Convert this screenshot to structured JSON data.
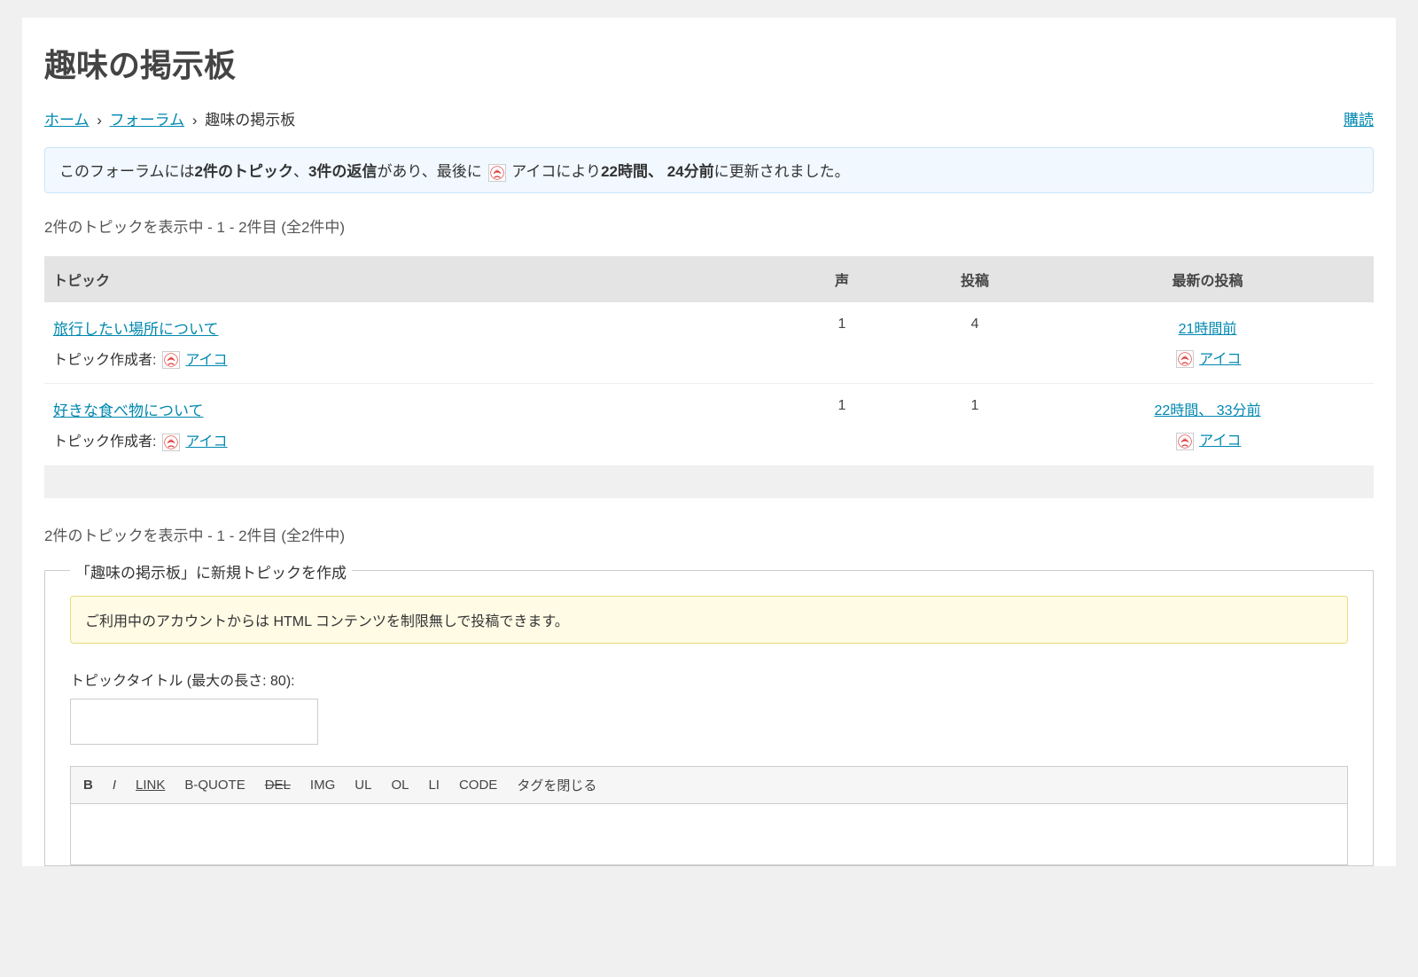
{
  "page": {
    "title": "趣味の掲示板"
  },
  "breadcrumb": {
    "home": "ホーム",
    "forums": "フォーラム",
    "current": "趣味の掲示板",
    "subscribe": "購読"
  },
  "notice": {
    "part1": "このフォーラムには",
    "topics": "2件のトピック",
    "sep1": "、",
    "replies": "3件の返信",
    "part2": "があり、最後に",
    "avatar_alt": "アバター",
    "author": "アイコ",
    "part3": "により",
    "time": "22時間、 24分前",
    "part4": "に更新されました。"
  },
  "pagination": {
    "top": "2件のトピックを表示中 - 1 - 2件目 (全2件中)",
    "bottom": "2件のトピックを表示中 - 1 - 2件目 (全2件中)"
  },
  "table": {
    "headers": {
      "topic": "トピック",
      "voice": "声",
      "post": "投稿",
      "freshness": "最新の投稿"
    },
    "starter_label": "トピック作成者:",
    "rows": [
      {
        "title": "旅行したい場所について",
        "author": "アイコ",
        "voices": "1",
        "posts": "4",
        "time": "21時間前",
        "last_author": "アイコ"
      },
      {
        "title": "好きな食べ物について",
        "author": "アイコ",
        "voices": "1",
        "posts": "1",
        "time": "22時間、 33分前",
        "last_author": "アイコ"
      }
    ]
  },
  "form": {
    "legend": "「趣味の掲示板」に新規トピックを作成",
    "warning": "ご利用中のアカウントからは HTML コンテンツを制限無しで投稿できます。",
    "title_label": "トピックタイトル (最大の長さ: 80):"
  },
  "toolbar": {
    "b": "B",
    "i": "I",
    "link": "LINK",
    "bquote": "B-QUOTE",
    "del": "DEL",
    "img": "IMG",
    "ul": "UL",
    "ol": "OL",
    "li": "LI",
    "code": "CODE",
    "close": "タグを閉じる"
  }
}
